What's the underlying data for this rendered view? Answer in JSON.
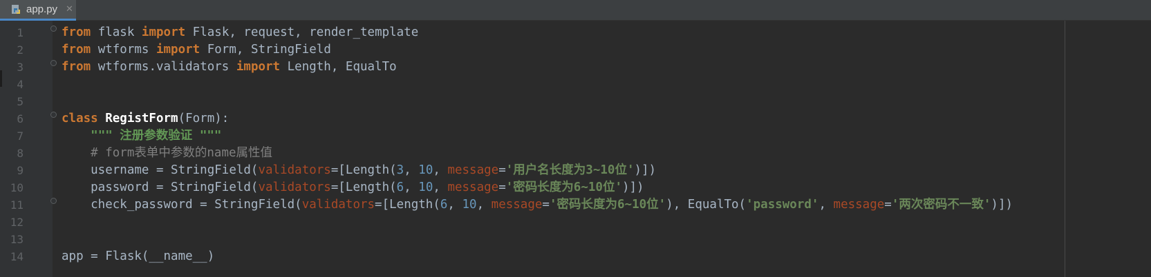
{
  "tab": {
    "title": "app.py",
    "icon": "python-file-icon",
    "close": "✕"
  },
  "colors": {
    "keyword": "#cc7832",
    "string": "#6a8759",
    "number": "#6897bb",
    "param": "#aa4926",
    "comment": "#808080"
  },
  "lines": [
    {
      "n": "1",
      "tokens": [
        [
          "kw",
          "from"
        ],
        [
          "pn",
          " flask "
        ],
        [
          "kw",
          "import"
        ],
        [
          "pn",
          " Flask, request, render_template"
        ]
      ]
    },
    {
      "n": "2",
      "tokens": [
        [
          "kw",
          "from"
        ],
        [
          "pn",
          " wtforms "
        ],
        [
          "kw",
          "import"
        ],
        [
          "pn",
          " Form, StringField"
        ]
      ]
    },
    {
      "n": "3",
      "tokens": [
        [
          "kw",
          "from"
        ],
        [
          "pn",
          " wtforms.validators "
        ],
        [
          "kw",
          "import"
        ],
        [
          "pn",
          " Length, EqualTo"
        ]
      ]
    },
    {
      "n": "4",
      "tokens": []
    },
    {
      "n": "5",
      "tokens": []
    },
    {
      "n": "6",
      "tokens": [
        [
          "kw",
          "class "
        ],
        [
          "cls",
          "RegistForm"
        ],
        [
          "pn",
          "(Form):"
        ]
      ]
    },
    {
      "n": "7",
      "tokens": [
        [
          "pn",
          "    "
        ],
        [
          "doc",
          "\"\"\" 注册参数验证 \"\"\""
        ]
      ]
    },
    {
      "n": "8",
      "tokens": [
        [
          "pn",
          "    "
        ],
        [
          "cmt",
          "# form表单中参数的name属性值"
        ]
      ]
    },
    {
      "n": "9",
      "tokens": [
        [
          "pn",
          "    username = StringField("
        ],
        [
          "prm",
          "validators"
        ],
        [
          "pn",
          "=[Length("
        ],
        [
          "num",
          "3"
        ],
        [
          "pn",
          ", "
        ],
        [
          "num",
          "10"
        ],
        [
          "pn",
          ", "
        ],
        [
          "prm",
          "message"
        ],
        [
          "pn",
          "="
        ],
        [
          "str",
          "'用户名长度为3~10位'"
        ],
        [
          "pn",
          ")])"
        ]
      ]
    },
    {
      "n": "10",
      "tokens": [
        [
          "pn",
          "    password = StringField("
        ],
        [
          "prm",
          "validators"
        ],
        [
          "pn",
          "=[Length("
        ],
        [
          "num",
          "6"
        ],
        [
          "pn",
          ", "
        ],
        [
          "num",
          "10"
        ],
        [
          "pn",
          ", "
        ],
        [
          "prm",
          "message"
        ],
        [
          "pn",
          "="
        ],
        [
          "str",
          "'密码长度为6~10位'"
        ],
        [
          "pn",
          ")])"
        ]
      ]
    },
    {
      "n": "11",
      "tokens": [
        [
          "pn",
          "    check_password = StringField("
        ],
        [
          "prm",
          "validators"
        ],
        [
          "pn",
          "=[Length("
        ],
        [
          "num",
          "6"
        ],
        [
          "pn",
          ", "
        ],
        [
          "num",
          "10"
        ],
        [
          "pn",
          ", "
        ],
        [
          "prm",
          "message"
        ],
        [
          "pn",
          "="
        ],
        [
          "str",
          "'密码长度为6~10位'"
        ],
        [
          "pn",
          "), EqualTo("
        ],
        [
          "str",
          "'password'"
        ],
        [
          "pn",
          ", "
        ],
        [
          "prm",
          "message"
        ],
        [
          "pn",
          "="
        ],
        [
          "str",
          "'两次密码不一致'"
        ],
        [
          "pn",
          ")])"
        ]
      ]
    },
    {
      "n": "12",
      "tokens": []
    },
    {
      "n": "13",
      "tokens": []
    },
    {
      "n": "14",
      "tokens": [
        [
          "pn",
          "app = Flask(__name__)"
        ]
      ]
    }
  ]
}
